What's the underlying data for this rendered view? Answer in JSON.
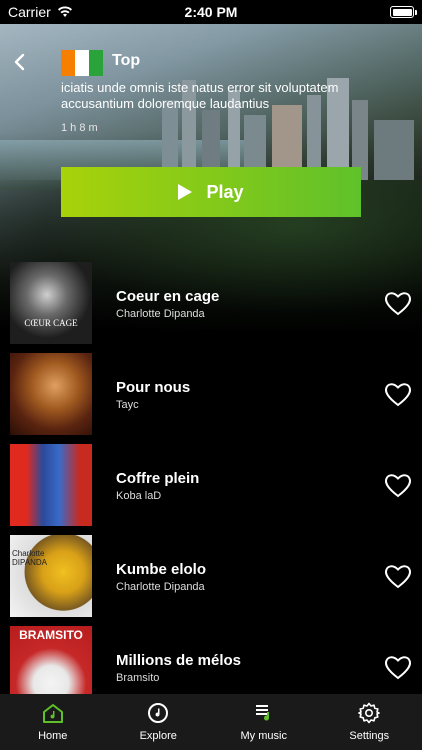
{
  "status": {
    "carrier": "Carrier",
    "time": "2:40 PM"
  },
  "header": {
    "title": "Top",
    "description": "iciatis unde omnis iste natus error sit voluptatem accusantium doloremque laudantius",
    "duration": "1 h 8 m",
    "play_label": "Play"
  },
  "songs": [
    {
      "title": "Coeur en cage",
      "artist": "Charlotte Dipanda",
      "cover_text": "CŒUR CAGE"
    },
    {
      "title": "Pour nous",
      "artist": "Tayc",
      "cover_text": ""
    },
    {
      "title": "Coffre plein",
      "artist": "Koba laD",
      "cover_text": ""
    },
    {
      "title": "Kumbe elolo",
      "artist": "Charlotte Dipanda",
      "cover_text": "Charlotte DIPANDA"
    },
    {
      "title": "Millions de mélos",
      "artist": "Bramsito",
      "cover_text": "BRAMSITO"
    }
  ],
  "tabs": [
    {
      "label": "Home",
      "icon": "home-icon",
      "active": true
    },
    {
      "label": "Explore",
      "icon": "compass-icon",
      "active": false
    },
    {
      "label": "My music",
      "icon": "playlist-icon",
      "active": false
    },
    {
      "label": "Settings",
      "icon": "gear-icon",
      "active": false
    }
  ],
  "colors": {
    "accent": "#7fc41f",
    "tabbar": "#1a1a1a",
    "home_icon": "#5fc12a"
  }
}
